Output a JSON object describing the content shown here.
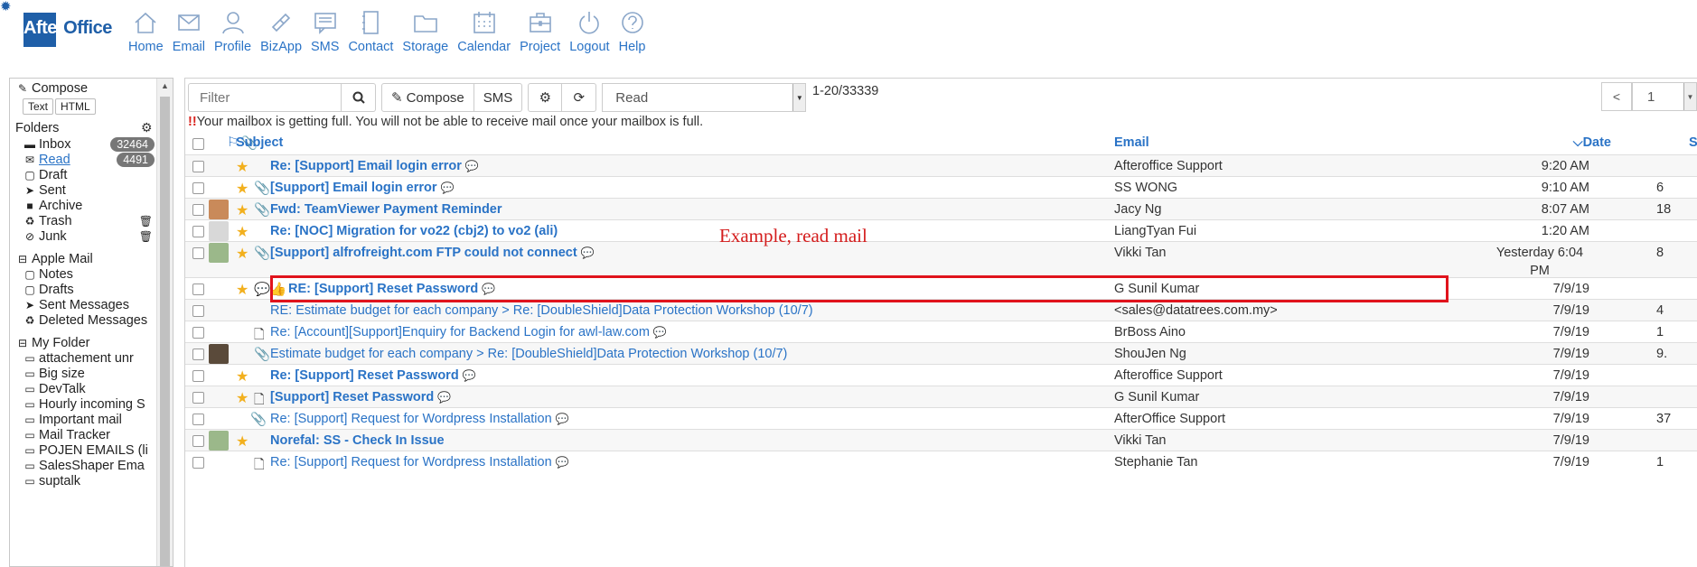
{
  "app": {
    "logo_text_a": "After",
    "logo_text_b": "Office"
  },
  "nav": [
    {
      "label": "Home",
      "icon": "home-icon"
    },
    {
      "label": "Email",
      "icon": "email-icon"
    },
    {
      "label": "Profile",
      "icon": "profile-icon"
    },
    {
      "label": "BizApp",
      "icon": "bizapp-icon"
    },
    {
      "label": "SMS",
      "icon": "sms-icon"
    },
    {
      "label": "Contact",
      "icon": "contact-icon"
    },
    {
      "label": "Storage",
      "icon": "storage-icon"
    },
    {
      "label": "Calendar",
      "icon": "calendar-icon"
    },
    {
      "label": "Project",
      "icon": "project-icon"
    },
    {
      "label": "Logout",
      "icon": "logout-icon"
    },
    {
      "label": "Help",
      "icon": "help-icon"
    }
  ],
  "sidebar": {
    "compose": "Compose",
    "text_btn": "Text",
    "html_btn": "HTML",
    "folders_title": "Folders",
    "folders": [
      {
        "label": "Inbox",
        "badge": "32464",
        "icon": "inbox-icon"
      },
      {
        "label": "Read",
        "badge": "4491",
        "icon": "read-icon"
      },
      {
        "label": "Draft",
        "icon": "draft-icon"
      },
      {
        "label": "Sent",
        "icon": "sent-icon"
      },
      {
        "label": "Archive",
        "icon": "archive-icon"
      },
      {
        "label": "Trash",
        "icon": "trash-icon"
      },
      {
        "label": "Junk",
        "icon": "junk-icon"
      }
    ],
    "apple_mail_title": "Apple Mail",
    "apple_mail": [
      "Notes",
      "Drafts",
      "Sent Messages",
      "Deleted Messages"
    ],
    "my_folder_title": "My Folder",
    "my_folder": [
      "attachement unr",
      "Big size",
      "DevTalk",
      "Hourly incoming S",
      "Important mail",
      "Mail Tracker",
      "POJEN EMAILS (li",
      "SalesShaper Ema",
      "suptalk"
    ]
  },
  "toolbar": {
    "filter_placeholder": "Filter",
    "compose": "Compose",
    "sms": "SMS",
    "view_select": "Read",
    "count": "1-20/33339",
    "page": "1"
  },
  "warning": {
    "bang": "!!",
    "text": "Your mailbox is getting full. You will not be able to receive mail once your mailbox is full."
  },
  "table": {
    "headers": {
      "subject": "Subject",
      "email": "Email",
      "date": "Date",
      "size": "Si"
    },
    "rows": [
      {
        "subject": "Re: [Support] Email login error",
        "email": "Afteroffice Support",
        "date": "9:20 AM",
        "size": "",
        "bold": true,
        "star": true,
        "attach": false,
        "chat": true
      },
      {
        "subject": "[Support] Email login error",
        "email": "SS WONG",
        "date": "9:10 AM",
        "size": "6",
        "bold": true,
        "star": true,
        "attach": true,
        "chat": true
      },
      {
        "subject": "Fwd: TeamViewer Payment Reminder",
        "email": "Jacy Ng",
        "date": "8:07 AM",
        "size": "18",
        "bold": true,
        "star": true,
        "attach": true,
        "chat": false
      },
      {
        "subject": "Re: [NOC] Migration for vo22 (cbj2) to vo2 (ali)",
        "email": "LiangTyan Fui",
        "date": "1:20 AM",
        "size": "",
        "bold": true,
        "star": true,
        "attach": false,
        "chat": false
      },
      {
        "subject": "[Support] alfrofreight.com FTP could not connect",
        "email": "Vikki Tan",
        "date": "Yesterday 6:04",
        "date2": "PM",
        "size": "8",
        "bold": true,
        "star": true,
        "attach": true,
        "chat": true
      },
      {
        "subject": "RE: [Support] Reset Password",
        "email": "G Sunil Kumar",
        "date": "7/9/19",
        "size": "",
        "bold": true,
        "star": true,
        "attach": false,
        "chat": true
      },
      {
        "subject": "RE: Estimate budget for each company > Re: [DoubleShield]Data Protection Workshop (10/7)",
        "email": "<sales@datatrees.com.my>",
        "date": "7/9/19",
        "size": "4",
        "bold": false,
        "star": false,
        "attach": false,
        "chat": false
      },
      {
        "subject": "Re: [Account][Support]Enquiry for Backend Login for awl-law.com",
        "email": "BrBoss Aino",
        "date": "7/9/19",
        "size": "1",
        "bold": false,
        "star": false,
        "attach": false,
        "chat": true
      },
      {
        "subject": "Estimate budget for each company > Re: [DoubleShield]Data Protection Workshop (10/7)",
        "email": "ShouJen Ng",
        "date": "7/9/19",
        "size": "9.",
        "bold": false,
        "star": false,
        "attach": true,
        "chat": false
      },
      {
        "subject": "Re: [Support] Reset Password",
        "email": "Afteroffice Support",
        "date": "7/9/19",
        "size": "",
        "bold": true,
        "star": true,
        "attach": false,
        "chat": true
      },
      {
        "subject": "[Support] Reset Password",
        "email": "G Sunil Kumar",
        "date": "7/9/19",
        "size": "",
        "bold": true,
        "star": true,
        "attach": false,
        "chat": true
      },
      {
        "subject": "Re: [Support] Request for Wordpress Installation",
        "email": "AfterOffice Support",
        "date": "7/9/19",
        "size": "37",
        "bold": false,
        "star": false,
        "attach": true,
        "chat": true
      },
      {
        "subject": "Norefal: SS - Check In Issue",
        "email": "Vikki Tan",
        "date": "7/9/19",
        "size": "",
        "bold": true,
        "star": true,
        "attach": false,
        "chat": false
      },
      {
        "subject": "Re: [Support] Request for Wordpress Installation",
        "email": "Stephanie Tan",
        "date": "7/9/19",
        "size": "1",
        "bold": false,
        "star": false,
        "attach": false,
        "chat": true
      }
    ]
  },
  "annotation": "Example, read mail",
  "colors": {
    "accent": "#2a73c6",
    "highlight": "#e0131c",
    "star": "#f2b01e"
  }
}
